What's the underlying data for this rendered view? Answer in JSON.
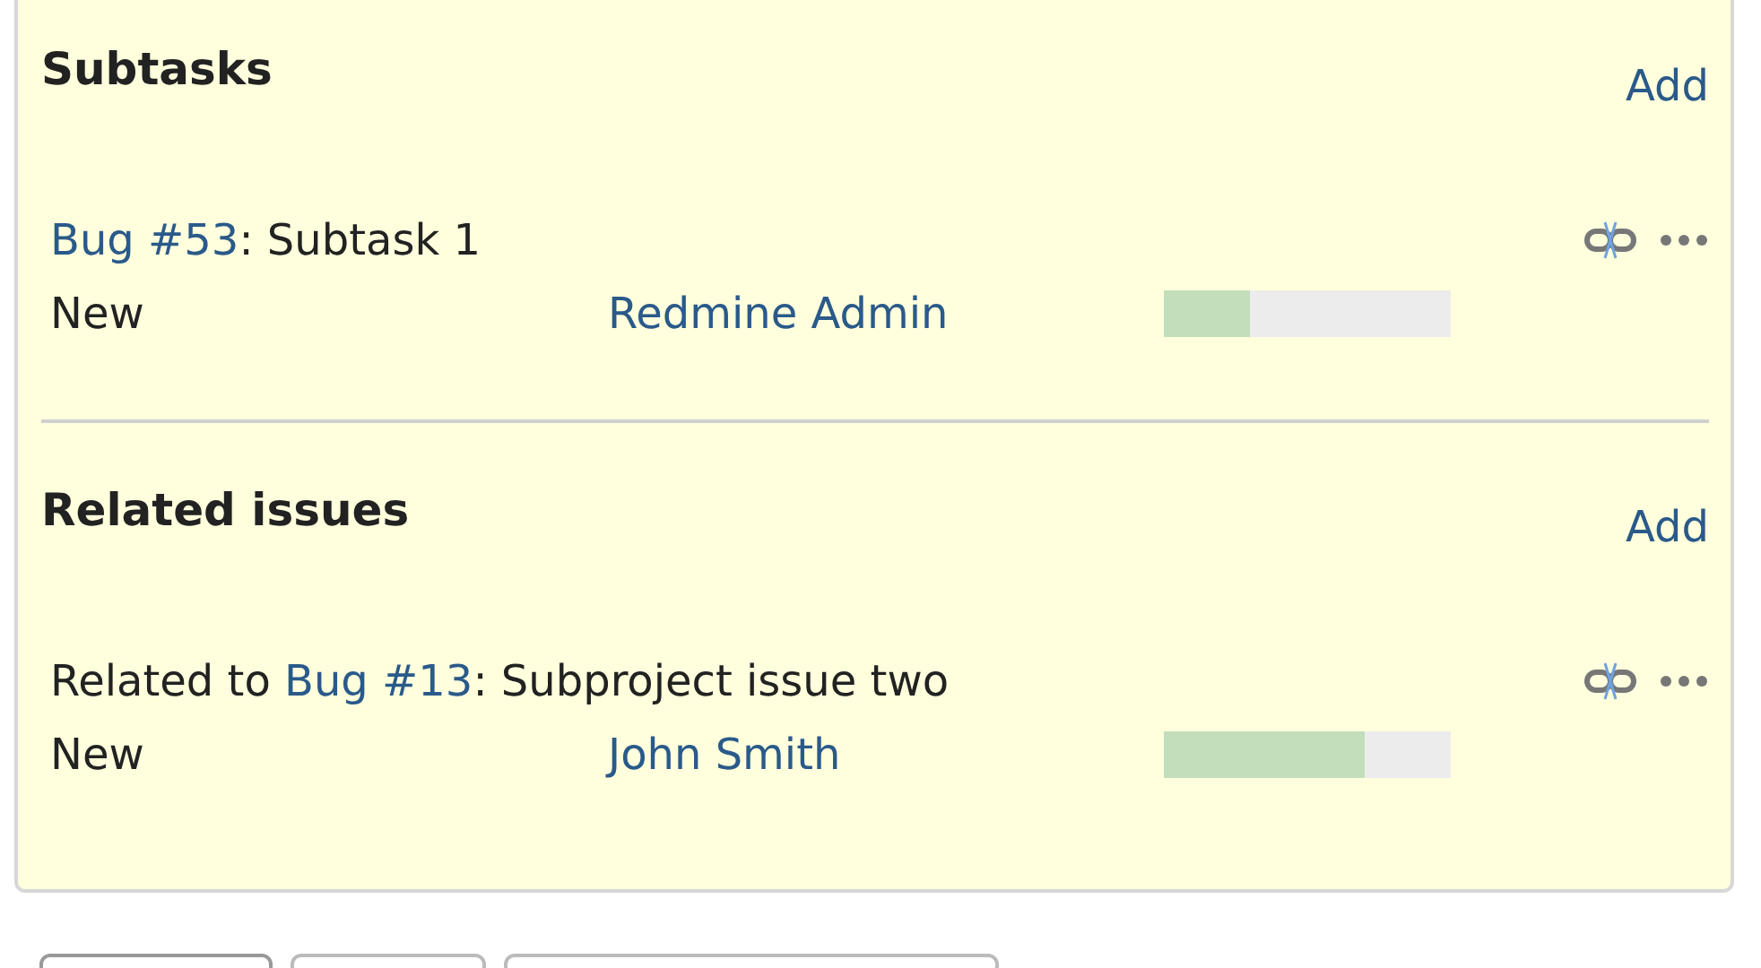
{
  "sections": [
    {
      "title": "Subtasks",
      "add": "Add",
      "items": [
        {
          "link": "Bug #53",
          "rest": ": Subtask 1",
          "status": "New",
          "assignee": "Redmine Admin",
          "level": 0.3
        }
      ]
    },
    {
      "title": "Related issues",
      "add": "Add",
      "items": [
        {
          "prefix": "Related to ",
          "link": "Bug #13",
          "rest": ": Subproject issue two",
          "status": "New",
          "assignee": "John Smith",
          "level": 0.7
        }
      ]
    }
  ],
  "buttons": [
    {
      "kind": "button"
    },
    {
      "kind": "button"
    },
    {
      "kind": "button"
    }
  ]
}
